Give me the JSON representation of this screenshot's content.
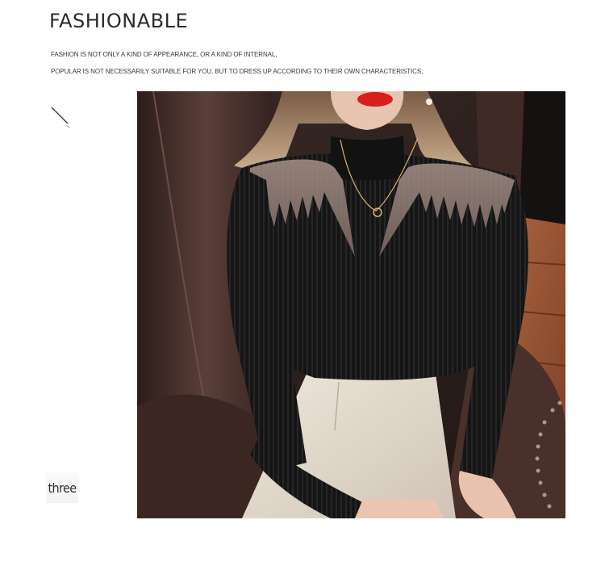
{
  "headline": "FASHIONABLE",
  "taglines": [
    "FASHION IS NOT ONLY A KIND OF APPEARANCE, OR A KIND OF INTERNAL,",
    "POPULAR IS NOT NECESSARILY SUITABLE FOR YOU, BUT TO DRESS UP ACCORDING TO THEIR OWN CHARACTERISTICS,"
  ],
  "photo_label": "three",
  "photo": {
    "subject": "model wearing black ribbed knit long-sleeve top with sheer mesh yoke and cream skirt, seated in brown leather armchair",
    "colors": {
      "top": "#141414",
      "skirt": "#e4dcd1",
      "chair": "#3c2723",
      "floor": "#8a4b2d",
      "lips": "#d7201b"
    }
  },
  "icons": [
    "diagonal-slash-icon"
  ]
}
